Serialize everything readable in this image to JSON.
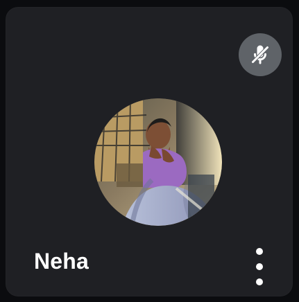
{
  "participant": {
    "name": "Neha"
  },
  "status": {
    "mic_icon": "mic-off-icon"
  },
  "menu": {
    "icon": "more-vertical-icon"
  },
  "colors": {
    "tile_background": "#1f2024",
    "mute_badge_background": "#5f6368",
    "text": "#ffffff"
  }
}
